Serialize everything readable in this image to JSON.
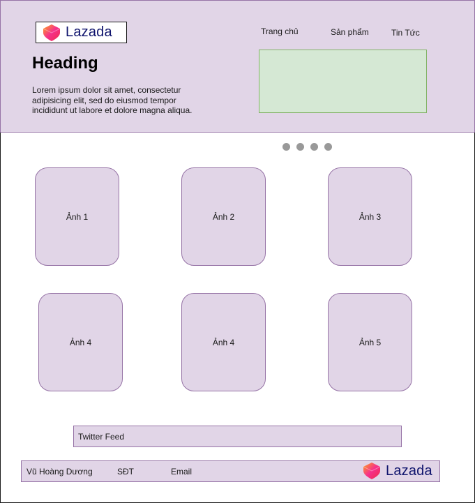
{
  "header": {
    "logo_text": "Lazada",
    "nav": [
      "Trang chủ",
      "Sản phẩm",
      "Tin Tức"
    ],
    "heading": "Heading",
    "description": "Lorem ipsum dolor sit amet, consectetur adipisicing elit, sed do eiusmod tempor incididunt ut labore et dolore magna aliqua."
  },
  "carousel": {
    "dot_count": 4
  },
  "gallery": {
    "cards": [
      "Ảnh 1",
      "Ảnh 2",
      "Ảnh 3",
      "Ảnh 4",
      "Ảnh 4",
      "Ảnh 5"
    ]
  },
  "twitter": {
    "label": "Twitter Feed"
  },
  "footer": {
    "name": "Vũ Hoàng Dương",
    "phone": "SĐT",
    "email": "Email",
    "logo_text": "Lazada"
  },
  "colors": {
    "purple_fill": "#e1d5e7",
    "purple_border": "#9673a6",
    "green_fill": "#d5e8d4",
    "green_border": "#82b366",
    "logo_text": "#0f146d",
    "dot": "#999999"
  },
  "icons": {
    "logo": "lazada-heart-icon"
  }
}
